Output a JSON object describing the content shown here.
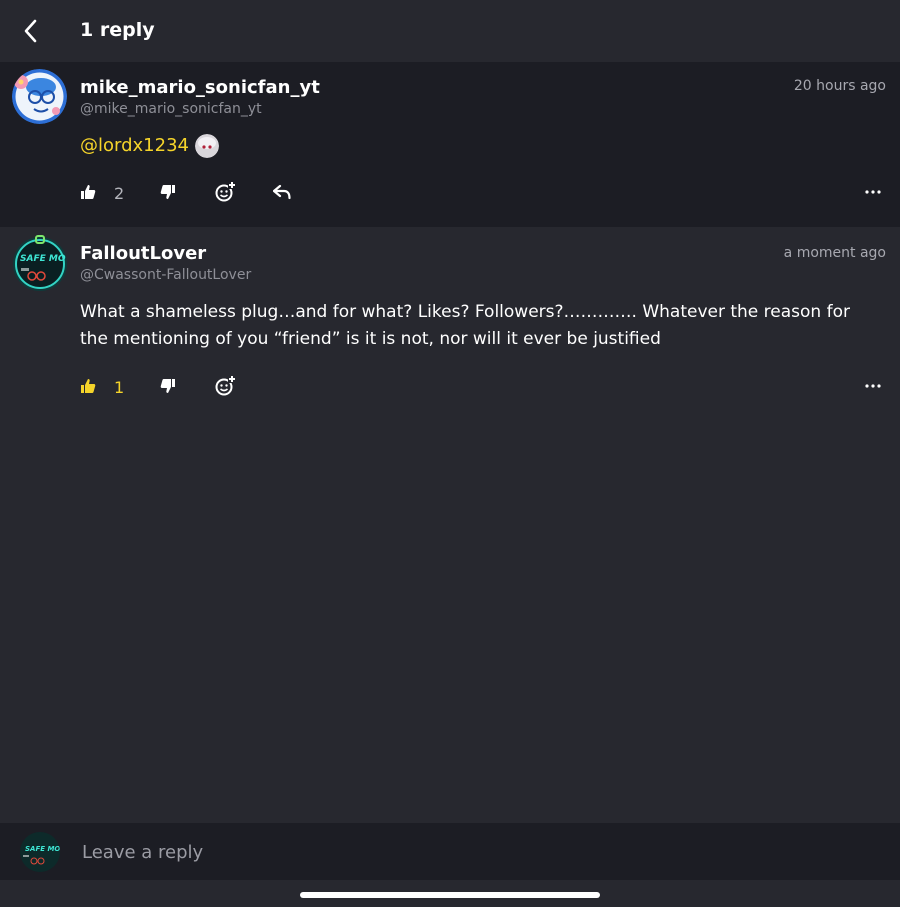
{
  "header": {
    "title": "1 reply"
  },
  "parent_comment": {
    "username": "mike_mario_sonicfan_yt",
    "handle": "@mike_mario_sonicfan_yt",
    "timestamp": "20 hours ago",
    "mention": "@lordx1234",
    "like_count": "2"
  },
  "reply_comment": {
    "username": "FalloutLover",
    "handle": "@Cwassont-FalloutLover",
    "timestamp": "a moment ago",
    "text": "What a shameless plug…and for what? Likes? Followers?…………. Whatever the reason for the mentioning of you “friend” is it is not, nor will it ever be justified",
    "like_count": "1",
    "avatar_text": "SAFE MO"
  },
  "reply_box": {
    "placeholder": "Leave a reply",
    "avatar_text": "SAFE MO"
  },
  "colors": {
    "accent": "#f5d42a",
    "background": "#27282f",
    "panel": "#1c1d24"
  },
  "icons": [
    "back-arrow-icon",
    "thumbs-up-icon",
    "thumbs-down-icon",
    "add-emoji-icon",
    "reply-icon",
    "more-icon"
  ]
}
